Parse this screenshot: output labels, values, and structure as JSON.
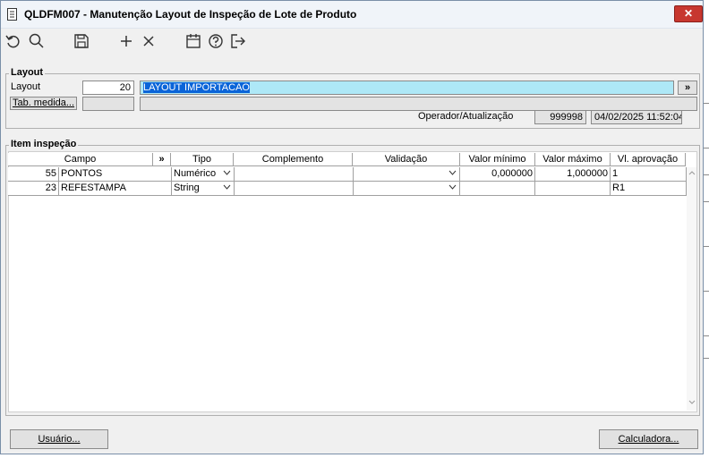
{
  "window": {
    "title": "QLDFM007 - Manutenção Layout de Inspeção de Lote de Produto",
    "close_label": "✕"
  },
  "toolbar": {
    "icons": [
      "undo-icon",
      "search-icon",
      "save-icon",
      "add-icon",
      "delete-icon",
      "calendar-icon",
      "help-icon",
      "exit-icon"
    ]
  },
  "layout": {
    "group_label": "Layout",
    "field_label": "Layout",
    "code": "20",
    "description": "LAYOUT IMPORTACAO",
    "more_button": "»",
    "tab_medida_button": "Tab. medida...",
    "tab_medida_value": "",
    "tab_medida_desc": "",
    "operator_label": "Operador/Atualização",
    "operator_code": "999998",
    "updated_at": "04/02/2025 11:52:04"
  },
  "items": {
    "group_label": "Item inspeção",
    "more_button": "»",
    "columns": [
      "Campo",
      "Tipo",
      "Complemento",
      "Validação",
      "Valor mínimo",
      "Valor máximo",
      "Vl. aprovação"
    ],
    "rows": [
      {
        "code": "55",
        "campo": "PONTOS",
        "tipo": "Numérico",
        "complemento": "",
        "validacao": "",
        "valor_minimo": "0,000000",
        "valor_maximo": "1,000000",
        "vl_aprovacao": "1"
      },
      {
        "code": "23",
        "campo": "REFESTAMPA",
        "tipo": "String",
        "complemento": "",
        "validacao": "",
        "valor_minimo": "",
        "valor_maximo": "",
        "vl_aprovacao": "R1"
      }
    ]
  },
  "footer": {
    "usuario_button": "Usuário...",
    "calculadora_button": "Calculadora..."
  },
  "colors": {
    "selection": "#aee8f7",
    "title_close": "#c7372f",
    "window_bg": "#f0f0f0"
  }
}
